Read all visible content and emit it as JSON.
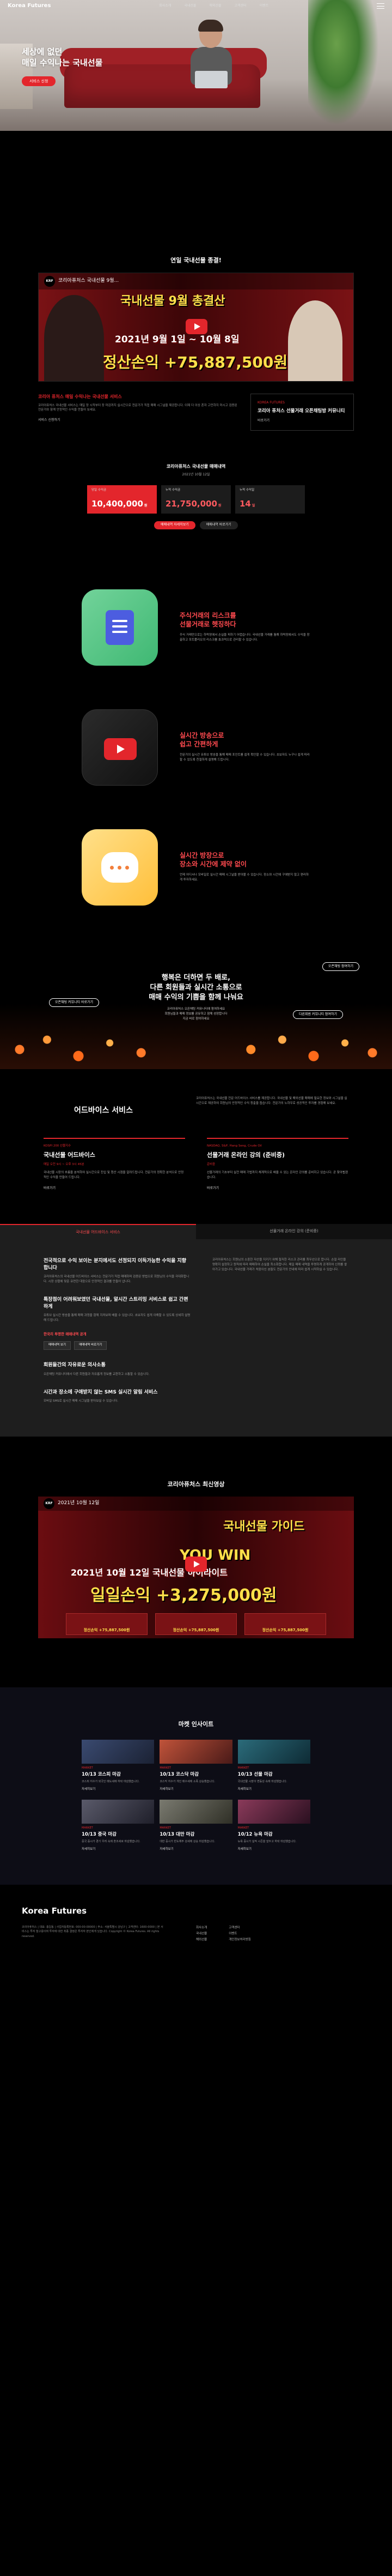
{
  "header": {
    "logo": "Korea Futures",
    "nav": [
      "회사소개",
      "국내선물",
      "해외선물",
      "고객센터",
      "이벤트"
    ]
  },
  "hero": {
    "line1": "세상에 없던",
    "line2": "매일 수익나는 국내선물",
    "button": "서비스 신청"
  },
  "video": {
    "section_title": "연일 국내선물 종결!",
    "channel_badge": "KRF",
    "video_title": "코리아퓨처스 국내선물 9월...",
    "overlay_title": "국내선물 9월 총결산",
    "overlay_date": "2021년 9월 1일 ~ 10월 8일",
    "overlay_profit": "정산손익 +75,887,500원"
  },
  "info": {
    "heading": "코리아 퓨처스 매일 수익나는 국내선물 서비스",
    "body": "코리아퓨처스 국내선물 서비스는 매일 장 시작부터 장 마감까지 실시간으로 전문가가 직접 매매 시그널을 제공합니다. 이제 더 이상 혼자 고민하지 마시고 검증된 전문가와 함께 안정적인 수익을 만들어 보세요.",
    "link": "서비스 신청하기",
    "card_kicker": "KOREA FUTURES",
    "card_title": "코리아 퓨처스 선물거래 오픈채팅방 커뮤니티",
    "card_link": "바로가기"
  },
  "stats": {
    "title": "코리아퓨처스 국내선물 매매내역",
    "date": "2021년 10월 12일",
    "cards": [
      {
        "label": "당일 수익금",
        "value": "10,400,000",
        "unit": "원"
      },
      {
        "label": "누적 수익금",
        "value": "21,750,000",
        "unit": "원"
      },
      {
        "label": "누적 수익일",
        "value": "14",
        "unit": "일"
      }
    ],
    "btn_primary": "매매내역 자세히보기",
    "btn_secondary": "매매내역 바로가기"
  },
  "features": [
    {
      "icon": "document-icon",
      "title1": "주식거래의 리스크를",
      "title2": "선물거래로 헷징하다",
      "desc": "주식 거래만으로는 하락장에서 손실을 피하기 어렵습니다. 국내선물 거래를 통해 하락장에서도 수익을 창출하고 포트폴리오의 리스크를 효과적으로 관리할 수 있습니다."
    },
    {
      "icon": "youtube-icon",
      "title1": "실시간 방송으로",
      "title2": "쉽고 간편하게",
      "desc": "전문가의 실시간 유튜브 방송을 통해 매매 포인트를 쉽게 확인할 수 있습니다. 초보자도 누구나 쉽게 따라할 수 있도록 친절하게 설명해 드립니다."
    },
    {
      "icon": "chat-icon",
      "title1": "실시간 방장으로",
      "title2": "장소와 시간에 제약 없이",
      "desc": "언제 어디서나 모바일로 실시간 매매 시그널을 받아볼 수 있습니다. 장소와 시간에 구애받지 않고 편리하게 투자하세요."
    }
  ],
  "promo": {
    "line1": "행복은 더하면 두 배로,",
    "line2": "다른 회원들과 실시간 소통으로",
    "line3": "매매 수익의 기쁨을 함께 나눠요",
    "desc1": "코리아퓨처스 오픈채팅 커뮤니티에 참여하세요",
    "desc2": "회원님들과 매매 정보를 공유하고 함께 성장합니다",
    "desc3": "지금 바로 참여하세요",
    "btn_top": "오픈채팅 참여하기",
    "btn_left": "오픈채팅 커뮤니티 바로가기",
    "btn_right": "다른회원 커뮤니티 참여하기"
  },
  "advice": {
    "title": "어드바이스 서비스",
    "intro": "코리아퓨처스는 국내선물 전문 어드바이스 서비스를 제공합니다. 국내선물 및 해외선물 매매에 필요한 정보와 시그널을 실시간으로 제공하여 회원님의 안정적인 수익 창출을 돕습니다. 전문가의 노하우로 성공적인 투자를 경험해 보세요.",
    "cols": [
      {
        "tag": "KOSPI 200 선물지수",
        "title": "국내선물 어드바이스",
        "red": "매일 오전 9시 ~ 오후 3시 45분",
        "desc": "국내선물 시장의 흐름을 분석하여 실시간으로 진입 및 청산 시점을 알려드립니다. 전문가의 정확한 분석으로 안정적인 수익을 만들어 드립니다.",
        "link": "바로가기"
      },
      {
        "tag": "NASDAQ, S&P, Hang Seng, Crude Oil",
        "title": "선물거래 온라인 강의 (준비중)",
        "red": "준비중",
        "desc": "선물거래의 기초부터 실전 매매 기법까지 체계적으로 배울 수 있는 온라인 강의를 준비하고 있습니다. 곧 찾아뵙겠습니다.",
        "link": "바로가기"
      }
    ]
  },
  "tabs": [
    {
      "label": "국내선물 어드바이스 서비스"
    },
    {
      "label": "선물거래 온라인 강의 (준비중)"
    }
  ],
  "article": {
    "h1": "전국적으로 수익 보이는 분지에서도 선정되지 이득가능한 수익을 지향합니다",
    "p1": "코리아퓨처스의 국내선물 어드바이스 서비스는 전문가가 직접 매매하며 검증된 방법으로 회원님의 수익을 극대화합니다. 시장 상황에 맞춘 유연한 대응으로 안정적인 결과를 만들어 냅니다.",
    "h2": "특장점이 어려워보였던 국내선물, 알시간 스트리밍 서비스로 쉽고 간편하게",
    "p2": "유튜브 실시간 방송을 통해 매매 과정을 함께 지켜보며 배울 수 있습니다. 초보자도 쉽게 이해할 수 있도록 상세히 설명해 드립니다.",
    "sub1": "한국리 투명한 매매내역 공개",
    "btn1": "매매내역 보기",
    "btn2": "매매내역 바로가기",
    "h3": "회원들간의 자유로운 의사소통",
    "p3": "오픈채팅 커뮤니티에서 다른 회원들과 자유롭게 정보를 교환하고 소통할 수 있습니다.",
    "h4": "시간과 장소에 구애받지 않는 SMS 실시간 알림 서비스",
    "p4": "모바일 SMS로 실시간 매매 시그널을 받아보실 수 있습니다.",
    "right": "코리아퓨처스는 회원님의 소중한 자산을 지키기 위해 철저한 리스크 관리를 최우선으로 합니다. 손절 라인을 명확히 설정하고 원칙에 따라 매매하여 손실을 최소화합니다. 매일 매매 내역을 투명하게 공개하여 신뢰를 쌓아가고 있습니다. 국내선물 거래가 처음이신 분들도 전문가의 안내에 따라 쉽게 시작하실 수 있습니다."
  },
  "broadcast": {
    "title": "코리아퓨처스 최신영상",
    "channel_badge": "KRF",
    "video_title": "2021년 10월 12일",
    "overlay_guide": "국내선물 가이드",
    "overlay_youwin": "YOU WIN",
    "overlay_date": "2021년 10월 12일 국내선물 하이라이트",
    "overlay_profit": "일일손익 +3,275,000원",
    "thumbs": [
      "정산손익 +75,887,500원",
      "정산손익 +75,887,500원",
      "정산손익 +75,887,500원"
    ]
  },
  "news": {
    "title": "마켓 인사이트",
    "items": [
      {
        "cat": "MARKET",
        "title": "10/13 코스피 마감",
        "desc": "코스피 지수가 외국인 매도세에 하락 마감했습니다.",
        "link": "자세히보기"
      },
      {
        "cat": "MARKET",
        "title": "10/13 코스닥 마감",
        "desc": "코스닥 지수가 개인 매수세에 소폭 상승했습니다.",
        "link": "자세히보기"
      },
      {
        "cat": "MARKET",
        "title": "10/13 선물 마감",
        "desc": "국내선물 시장이 변동성 속에 마감했습니다.",
        "link": "자세히보기"
      },
      {
        "cat": "MARKET",
        "title": "10/13 중국 마감",
        "desc": "중국 증시가 경기 우려 속에 혼조세로 마감했습니다.",
        "link": "자세히보기"
      },
      {
        "cat": "MARKET",
        "title": "10/13 대만 마감",
        "desc": "대만 증시가 반도체주 강세에 상승 마감했습니다.",
        "link": "자세히보기"
      },
      {
        "cat": "MARKET",
        "title": "10/12 뉴욕 마감",
        "desc": "뉴욕 증시가 실적 시즌을 앞두고 하락 마감했습니다.",
        "link": "자세히보기"
      }
    ]
  },
  "footer": {
    "brand": "Korea Futures",
    "info": "코리아퓨처스 | 대표: 홍길동 | 사업자등록번호: 000-00-00000 | 주소: 서울특별시 강남구 | 고객센터: 1600-0000 | 본 서비스는 투자 참고용이며 투자에 대한 최종 결정은 투자자 본인에게 있습니다. Copyright © Korea Futures. All rights reserved.",
    "col1": [
      "회사소개",
      "국내선물",
      "해외선물"
    ],
    "col2": [
      "고객센터",
      "이벤트",
      "개인정보처리방침"
    ]
  }
}
